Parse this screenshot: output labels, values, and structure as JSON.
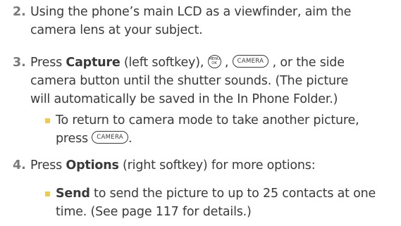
{
  "step2": {
    "number": "2.",
    "line1": "Using the phone’s main LCD as a viewfinder, aim the",
    "line2": "camera lens at your subject."
  },
  "step3": {
    "number": "3.",
    "press": "Press ",
    "capture": "Capture",
    "after_capture": " (left softkey), ",
    "comma": " , ",
    "rest_line1": " , or the side",
    "line2": "camera button until the shutter sounds. (The picture",
    "line3": "will automatically be saved in the In Phone Folder.)",
    "bullet1_line1": "To return to camera mode to take another picture,",
    "bullet1_press": "press ",
    "bullet1_end": "."
  },
  "step4": {
    "number": "4.",
    "press": "Press ",
    "options": "Options",
    "after_options": " (right softkey) for more options:",
    "bullet1_send": "Send",
    "bullet1_line1_rest": " to send the picture to up to 25 contacts at one",
    "bullet1_line2": "time. (See page 117 for details.)"
  },
  "keys": {
    "menu_ok_top": "MENU",
    "menu_ok_bottom": "OK",
    "camera": "CAMERA"
  },
  "colors": {
    "text": "#3a3a3a",
    "step_number": "#7a7a7a",
    "bullet": "#f2c94c"
  },
  "icons": {
    "menu_ok_key": "menu-ok-key-icon",
    "camera_key": "camera-key-icon",
    "bullet": "square-bullet"
  }
}
